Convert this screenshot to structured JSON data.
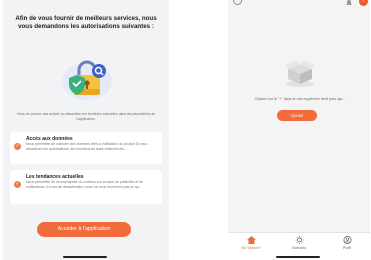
{
  "permissions_screen": {
    "title": "Afin de vous fournir de meilleurs services, nous vous demandons les autorisations suivantes :",
    "subtitle": "Vous ne pouvez pas activer ou désactiver les fonctions suivantes dans les paramètres de l'application.",
    "cards": [
      {
        "title": "Accès aux données",
        "body": "Nous permettre de collecter des données liées à l'utilisation du produit Si vous désactivez les autorisations, les fonctions de base resteront dis..."
      },
      {
        "title": "Les tendances actuelles",
        "body": "Nous permettre de recommander du contenu sur la base de publicités et de notifications. En cas de désactivation, nous ne vous enverrons pas ce qu..."
      }
    ],
    "access_button": "Accéder à l'application",
    "colors": {
      "accent": "#f26b3a",
      "background": "#f2f3f5"
    }
  },
  "home_screen": {
    "empty_hint": "Cliquez sur le \"+\" dans le coin supérieur droit pour ajo...",
    "add_button": "Ajouter",
    "add_icon_glyph": "+",
    "tabs": [
      {
        "label": "Ma \"Maison\"",
        "icon": "home-icon",
        "active": true
      },
      {
        "label": "Scénario",
        "icon": "scene-icon",
        "active": false
      },
      {
        "label": "Profil",
        "icon": "profile-icon",
        "active": false
      }
    ],
    "colors": {
      "accent": "#f26b3a",
      "active_tab": "#f26b3a"
    }
  }
}
